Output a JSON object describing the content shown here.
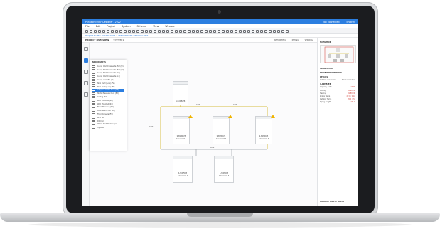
{
  "app": {
    "title": "Panasonic VRF Designer - 2022",
    "account": "Not connected",
    "language": "English"
  },
  "menu": [
    "File",
    "Edit",
    "Project",
    "System",
    "Scheme",
    "View",
    "Window"
  ],
  "breadcrumb": "PROJECT NAME > SYSTEM NAME > VRF OUTDOOR > INDOOR UNITS",
  "tabs": {
    "project_overview": "PROJECT OVERVIEW",
    "system_tab": "SYSTEM 1",
    "right": [
      "REPORTING",
      "PIPING",
      "WIRING"
    ]
  },
  "dropdown": {
    "header": "INDOOR UNITS",
    "items": [
      "4-way 90x90 cassette PU2 (U1)",
      "4-way 60x60 cassette PU2 (Y2)",
      "4-way 60x60 cassette (Y3)",
      "4-way 90x90 cassette (L1)",
      "2-way cassette (L1)",
      "Slim Duct (Low) (F2)",
      "Slim Duct (Low) (F3)",
      "Adaptive Static Duct (F3)",
      "Static Pressure Duct (E2)",
      "Ceiling (T2)",
      "Wall Mounted (K2)",
      "Wall Mounted (K1)",
      "Floor Standing (P1)",
      "Concealed Floor (R1)",
      "Floor Console (F1)",
      "AHU Kit",
      "DX Coil",
      "Water Heat Exchanger",
      "Hydrokit"
    ],
    "selected_index": 7
  },
  "diagram": {
    "top_unit": "U-10ME2E8",
    "pipe_labels": [
      "0.00",
      "0.00",
      "0.00",
      "0.00"
    ],
    "indoor_units": [
      {
        "model": "S-36MR1E5",
        "name": "Indoor Unit 1"
      },
      {
        "model": "S-36MR1E5",
        "name": "Indoor Unit 2"
      },
      {
        "model": "S-36MR1E5",
        "name": "Indoor Unit 3"
      }
    ],
    "lower_units": [
      {
        "model": "S-36MF1E5",
        "name": "Indoor Unit 4"
      },
      {
        "model": "S-36MF1E5",
        "name": "Indoor Unit 5"
      }
    ]
  },
  "right_panel": {
    "navigator": "NAVIGATOR",
    "information": "INFORMATION",
    "system_info": "SYSTEM INFORMATION",
    "details": "DETAILS",
    "radio": [
      "Outdoor connection",
      "Wind connection"
    ],
    "unit_model": "U-10ME2E8",
    "rows": [
      {
        "k": "Capacity Ratio",
        "v": "106%"
      },
      {
        "k": "Cooling",
        "v": "28.00 kW"
      },
      {
        "k": "Heating",
        "v": "31.50 kW"
      },
      {
        "k": "Indoor Temp",
        "v": "27.0 / 19.0"
      },
      {
        "k": "Outdoor Temp",
        "v": "35.0 / 7.0"
      },
      {
        "k": "Piping Length",
        "v": "0.00 m"
      }
    ],
    "footer": "CAPACITY SAFETY LIMITS"
  },
  "colors": {
    "accent": "#2b7ee0",
    "warning": "#f0b400",
    "alert": "#d0342c"
  }
}
